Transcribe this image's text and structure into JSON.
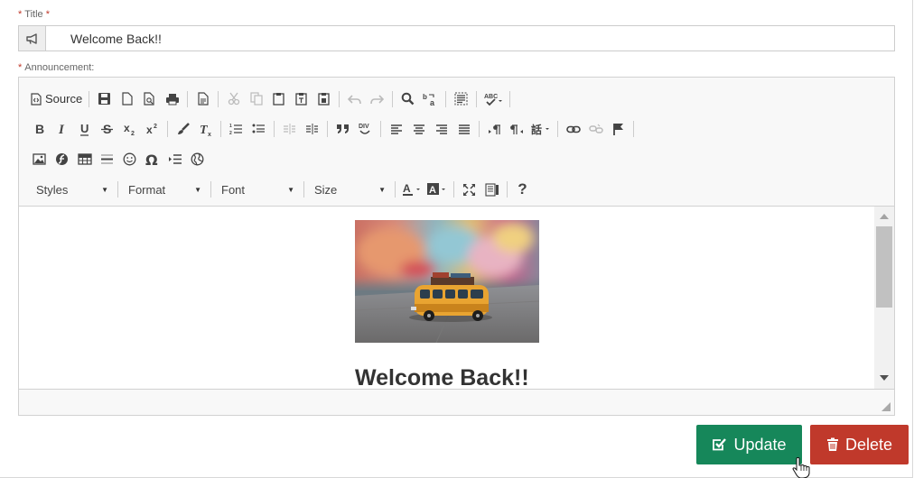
{
  "title_field": {
    "label": "Title",
    "required_marker": "*",
    "value": "Welcome Back!!",
    "addon_icon": "bullhorn-icon"
  },
  "announcement_field": {
    "label": "Announcement:",
    "required_marker": "*"
  },
  "editor": {
    "toolbar": {
      "source_label": "Source",
      "styles_label": "Styles",
      "format_label": "Format",
      "font_label": "Font",
      "size_label": "Size",
      "help_label": "?"
    },
    "content": {
      "image_description": "toy-bus-photo",
      "heading": "Welcome Back!!"
    }
  },
  "actions": {
    "update_label": "Update",
    "delete_label": "Delete"
  },
  "colors": {
    "update": "#16875a",
    "delete": "#c0392b",
    "required": "#c0392b"
  }
}
